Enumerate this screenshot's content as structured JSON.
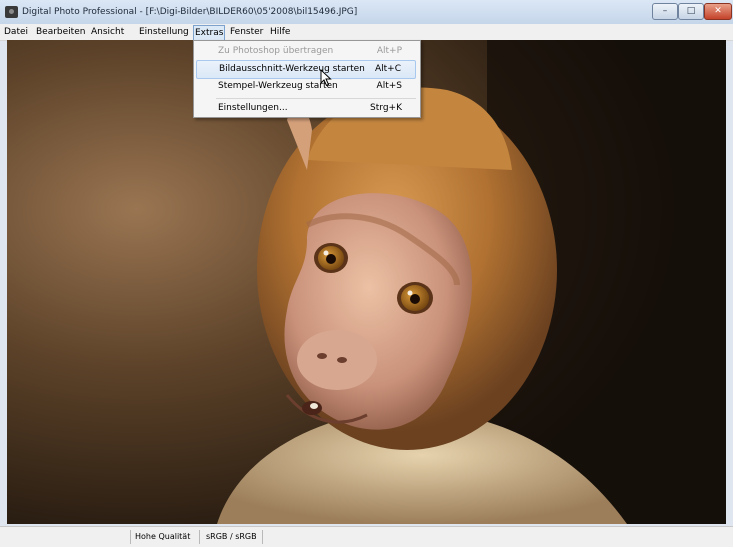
{
  "window": {
    "title": "Digital Photo Professional - [F:\\Digi-Bilder\\BILDER60\\05'2008\\bil15496.JPG]",
    "controls": [
      "minimize-icon",
      "maximize-icon",
      "close-icon"
    ]
  },
  "menubar": {
    "items": [
      "Datei",
      "Bearbeiten",
      "Ansicht",
      "Einstellung",
      "Extras",
      "Fenster",
      "Hilfe"
    ],
    "active": "Extras"
  },
  "extras_menu": {
    "items": [
      {
        "label": "Zu Photoshop übertragen",
        "shortcut": "Alt+P",
        "state": "disabled"
      },
      {
        "label": "Bildausschnitt-Werkzeug starten",
        "shortcut": "Alt+C",
        "state": "highlighted"
      },
      {
        "label": "Stempel-Werkzeug starten",
        "shortcut": "Alt+S",
        "state": "normal"
      },
      {
        "label": "Einstellungen...",
        "shortcut": "Strg+K",
        "state": "normal"
      }
    ]
  },
  "statusbar": {
    "quality": "Hohe Qualität",
    "color_space": "sRGB / sRGB"
  },
  "colors": {
    "titlebar": "#c5d6ea",
    "menu_highlight": "#dbe8f7",
    "close_button": "#c4432a"
  }
}
